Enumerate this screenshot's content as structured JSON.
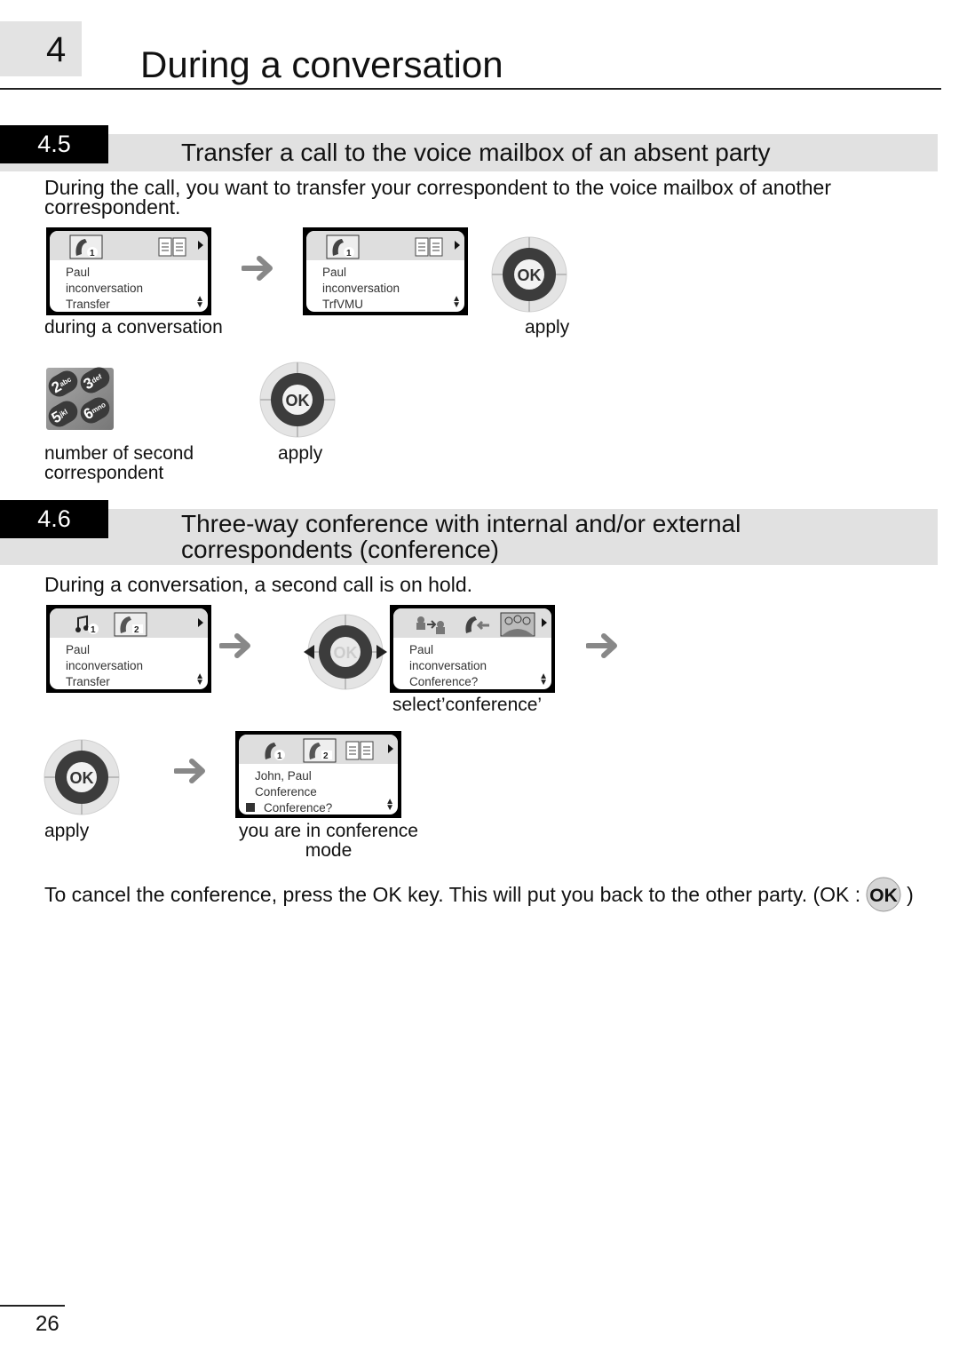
{
  "chapter": {
    "number": "4",
    "title": "During a conversation"
  },
  "sections": [
    {
      "number": "4.5",
      "title_lines": [
        "Transfer a call to the voice mailbox of an absent party"
      ],
      "intro_lines": [
        "During the call, you want to transfer your correspondent to the voice mailbox of another",
        "correspondent."
      ],
      "screens": [
        {
          "icons": [
            "handset-line-1-icon",
            "directory-icon"
          ],
          "lines": [
            "Paul",
            "inconversation",
            "Transfer"
          ]
        },
        {
          "icons": [
            "handset-line-1-icon",
            "directory-icon"
          ],
          "lines": [
            "Paul",
            "inconversation",
            "TrfVMU"
          ]
        }
      ],
      "captions": {
        "step1": "during a conversation",
        "ok1": "apply",
        "keypad": [
          "number of second",
          "correspondent"
        ],
        "ok2": "apply"
      },
      "keypad_keys": [
        {
          "digit": "2",
          "letters": "abc"
        },
        {
          "digit": "3",
          "letters": "def"
        },
        {
          "digit": "5",
          "letters": "jkl"
        },
        {
          "digit": "6",
          "letters": "mno"
        }
      ],
      "ok_label": "OK"
    },
    {
      "number": "4.6",
      "title_lines": [
        "Three-way conference with internal and/or external",
        "correspondents (conference)"
      ],
      "intro_lines": [
        "During a conversation, a second call is on hold."
      ],
      "screens": [
        {
          "icons": [
            "music-hold-line-1-icon",
            "handset-line-2-icon"
          ],
          "lines": [
            "Paul",
            "inconversation",
            "Transfer"
          ]
        },
        {
          "icons": [
            "transfer-users-icon",
            "handset-back-icon",
            "conference-group-icon"
          ],
          "lines": [
            "Paul",
            "inconversation",
            "Conference?"
          ]
        },
        {
          "icons": [
            "handset-line-1-icon",
            "handset-line-2-icon",
            "directory-icon"
          ],
          "lines": [
            "John, Paul",
            "Conference",
            "Conference?"
          ]
        }
      ],
      "captions": {
        "select": "select’conference’",
        "apply": "apply",
        "result": [
          "you are in conference",
          "mode"
        ]
      },
      "ok_label": "OK",
      "cancel_note": {
        "text": "To cancel the conference, press the OK key. This will put you back to the other party. (OK :",
        "close": ")",
        "ok_label": "OK"
      }
    }
  ],
  "page_number": "26"
}
